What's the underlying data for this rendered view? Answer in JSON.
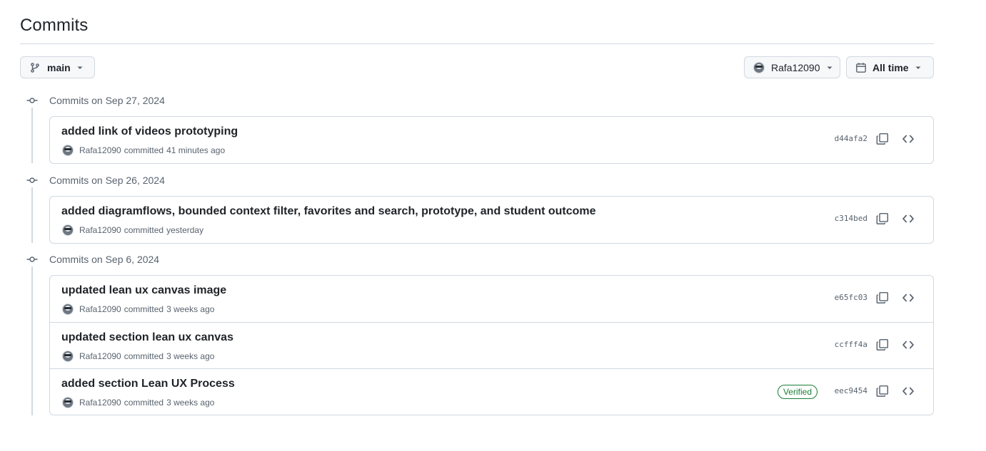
{
  "page": {
    "title": "Commits"
  },
  "filters": {
    "branch": "main",
    "user": "Rafa12090",
    "time": "All time"
  },
  "groups": [
    {
      "header": "Commits on Sep 27, 2024",
      "commits": [
        {
          "message": "added link of videos prototyping",
          "author": "Rafa12090",
          "verb": "committed",
          "when": "41 minutes ago",
          "sha": "d44afa2",
          "verified": ""
        }
      ]
    },
    {
      "header": "Commits on Sep 26, 2024",
      "commits": [
        {
          "message": "added diagramflows, bounded context filter, favorites and search, prototype, and student outcome",
          "author": "Rafa12090",
          "verb": "committed",
          "when": "yesterday",
          "sha": "c314bed",
          "verified": ""
        }
      ]
    },
    {
      "header": "Commits on Sep 6, 2024",
      "commits": [
        {
          "message": "updated lean ux canvas image",
          "author": "Rafa12090",
          "verb": "committed",
          "when": "3 weeks ago",
          "sha": "e65fc03",
          "verified": ""
        },
        {
          "message": "updated section lean ux canvas",
          "author": "Rafa12090",
          "verb": "committed",
          "when": "3 weeks ago",
          "sha": "ccfff4a",
          "verified": ""
        },
        {
          "message": "added section Lean UX Process",
          "author": "Rafa12090",
          "verb": "committed",
          "when": "3 weeks ago",
          "sha": "eec9454",
          "verified": "Verified"
        }
      ]
    }
  ],
  "colors": {
    "accent_verified": "#1a7f37",
    "border": "#d1d9e0",
    "muted_text": "#59636e"
  },
  "icons": [
    "git-branch-icon",
    "caret-down-icon",
    "calendar-icon",
    "git-commit-icon",
    "copy-icon",
    "code-icon",
    "avatar"
  ]
}
